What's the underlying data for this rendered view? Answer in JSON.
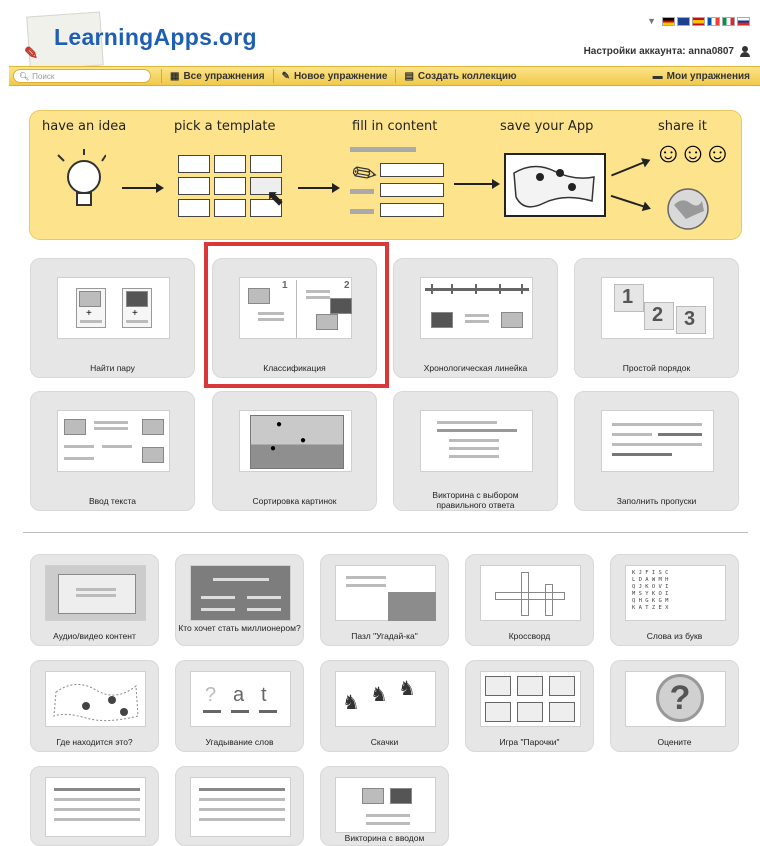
{
  "header": {
    "logo_text": "LearningApps.org",
    "account_label": "Настройки аккаунта: anna0807"
  },
  "nav": {
    "search_placeholder": "Поиск",
    "all_exercises": "Все упражнения",
    "new_exercise": "Новое упражнение",
    "create_collection": "Создать коллекцию",
    "my_exercises": "Мои упражнения"
  },
  "banner": {
    "steps": [
      "have an idea",
      "pick a template",
      "fill in content",
      "save your App",
      "share it"
    ]
  },
  "templates": [
    {
      "label": "Найти пару"
    },
    {
      "label": "Классификация"
    },
    {
      "label": "Хронологическая линейка"
    },
    {
      "label": "Простой порядок"
    },
    {
      "label": "Ввод текста"
    },
    {
      "label": "Сортировка картинок"
    },
    {
      "label": "Викторина с выбором правильного ответа"
    },
    {
      "label": "Заполнить пропуски"
    }
  ],
  "templates2": [
    {
      "label": "Аудио/видео контент"
    },
    {
      "label": "Кто хочет стать миллионером?"
    },
    {
      "label": "Пазл \"Угадай-ка\""
    },
    {
      "label": "Кроссворд"
    },
    {
      "label": "Слова из букв"
    },
    {
      "label": "Где находится это?"
    },
    {
      "label": "Угадывание слов"
    },
    {
      "label": "Скачки"
    },
    {
      "label": "Игра \"Парочки\""
    },
    {
      "label": "Оцените"
    },
    {
      "label": ""
    },
    {
      "label": ""
    },
    {
      "label": "Викторина с вводом"
    }
  ],
  "classification_numbers": [
    "1",
    "2"
  ],
  "order_numbers": [
    "1",
    "2",
    "3"
  ],
  "guess_word": [
    "?",
    "a",
    "t"
  ],
  "rate_symbol": "?",
  "wordgrid_rows": [
    "K J F I S C",
    "L D A W M H",
    "Q J K O V I",
    "M S Y K O I",
    "Q H G K G M",
    "K A T Z E X"
  ],
  "colors": {
    "accent_nav": "#f1c94a",
    "banner": "#fde48c",
    "selection": "#d9383a",
    "logo": "#1e5fb4"
  }
}
